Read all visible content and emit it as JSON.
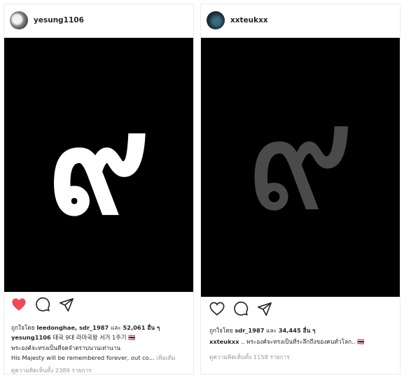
{
  "posts": [
    {
      "username": "yesung1106",
      "numeral": "๙",
      "liked": true,
      "likes": {
        "prefix": "ถูกใจโดย ",
        "users": "leedonghae, sdr_1987",
        "and": " และ ",
        "count": "52,061",
        "suffix": " อื่น ๆ"
      },
      "caption_user": "yesung1106",
      "caption_line1": " 태국 9대 라마국왕 서거 1주기 🇹🇭",
      "caption_line2": "พระองค์จะทรงเป็นที่จดจำตราบนานเท่านาน",
      "caption_line3": "His Majesty will be remembered forever, out co...",
      "more_label": " เพิ่มเติม",
      "comments": "ดูความคิดเห็นทั้ง 2389 รายการ"
    },
    {
      "username": "xxteukxx",
      "numeral": "๙",
      "liked": false,
      "likes": {
        "prefix": "ถูกใจโดย ",
        "users": "sdr_1987",
        "and": " และ ",
        "count": "34,445",
        "suffix": " อื่น ๆ"
      },
      "caption_user": "xxteukxx",
      "caption_line1": " .. พระองค์จะทรงเป็นที่ระลึกถึงของคนทั่วโลก.. 🇹🇭",
      "comments": "ดูความคิดเห็นทั้ง 1158 รายการ"
    }
  ],
  "colors": {
    "heart_liked": "#ed4956",
    "numeral_left": "#ffffff",
    "numeral_right": "#4a4a4a",
    "photo_bg": "#000000"
  },
  "icons": [
    "heart-icon",
    "comment-icon",
    "share-icon"
  ]
}
